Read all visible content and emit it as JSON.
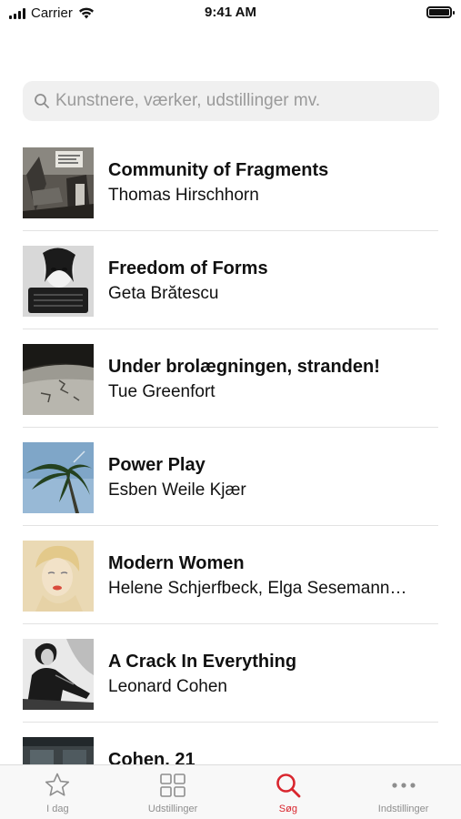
{
  "status_bar": {
    "carrier": "Carrier",
    "time": "9:41 AM"
  },
  "search": {
    "placeholder": "Kunstnere, værker, udstillinger mv.",
    "value": ""
  },
  "results": [
    {
      "title": "Community of Fragments",
      "artist": "Thomas Hirschhorn"
    },
    {
      "title": "Freedom of Forms",
      "artist": "Geta Brătescu"
    },
    {
      "title": "Under brolægningen, stranden!",
      "artist": "Tue Greenfort"
    },
    {
      "title": "Power Play",
      "artist": "Esben Weile Kjær"
    },
    {
      "title": "Modern Women",
      "artist": "Helene Schjerfbeck, Elga Sesemann…"
    },
    {
      "title": "A Crack In Everything",
      "artist": "Leonard Cohen"
    },
    {
      "title": "Cohen, 21",
      "artist": ""
    }
  ],
  "tab_bar": {
    "tabs": [
      {
        "label": "I dag",
        "icon": "star-icon"
      },
      {
        "label": "Udstillinger",
        "icon": "grid-icon"
      },
      {
        "label": "Søg",
        "icon": "search-icon"
      },
      {
        "label": "Indstillinger",
        "icon": "more-icon"
      }
    ],
    "active": "Søg",
    "accent_color": "#d9262e"
  }
}
